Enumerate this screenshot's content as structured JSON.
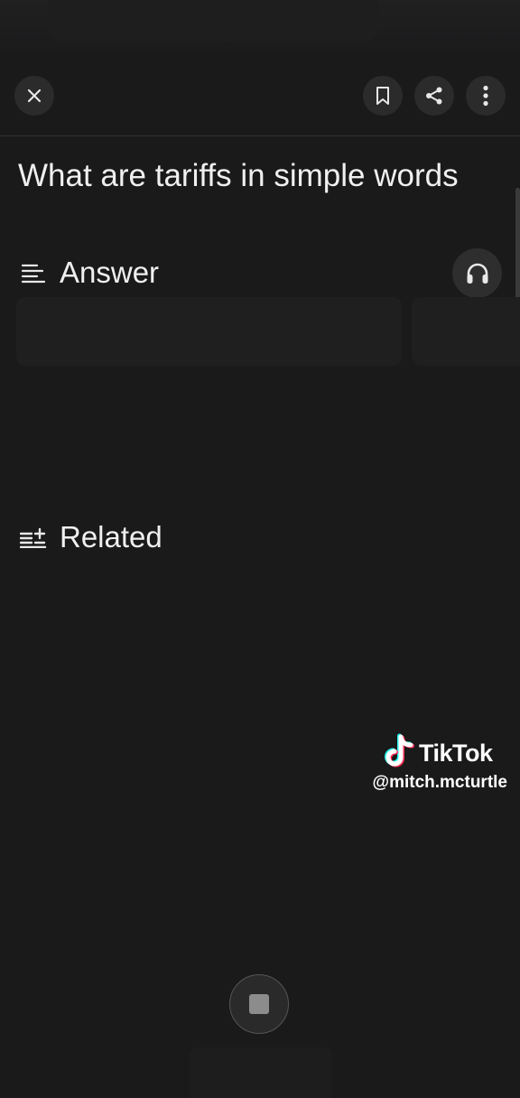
{
  "header": {
    "close_icon": "close-icon",
    "bookmark_icon": "bookmark-icon",
    "share_icon": "share-icon",
    "more_icon": "more-vertical-icon"
  },
  "query": {
    "title": "What are tariffs in simple words"
  },
  "answer_section": {
    "label": "Answer",
    "icon": "text-lines-icon",
    "listen_icon": "headphones-icon"
  },
  "related_section": {
    "label": "Related",
    "icon": "list-plus-icon"
  },
  "watermark": {
    "brand": "TikTok",
    "handle": "@mitch.mcturtle"
  },
  "controls": {
    "stop_icon": "stop-icon"
  },
  "colors": {
    "background": "#1a1a1b",
    "button_bg": "#2b2b2c",
    "text": "#f0f0f0",
    "tiktok_cyan": "#25f4ee",
    "tiktok_pink": "#fe2c55"
  }
}
